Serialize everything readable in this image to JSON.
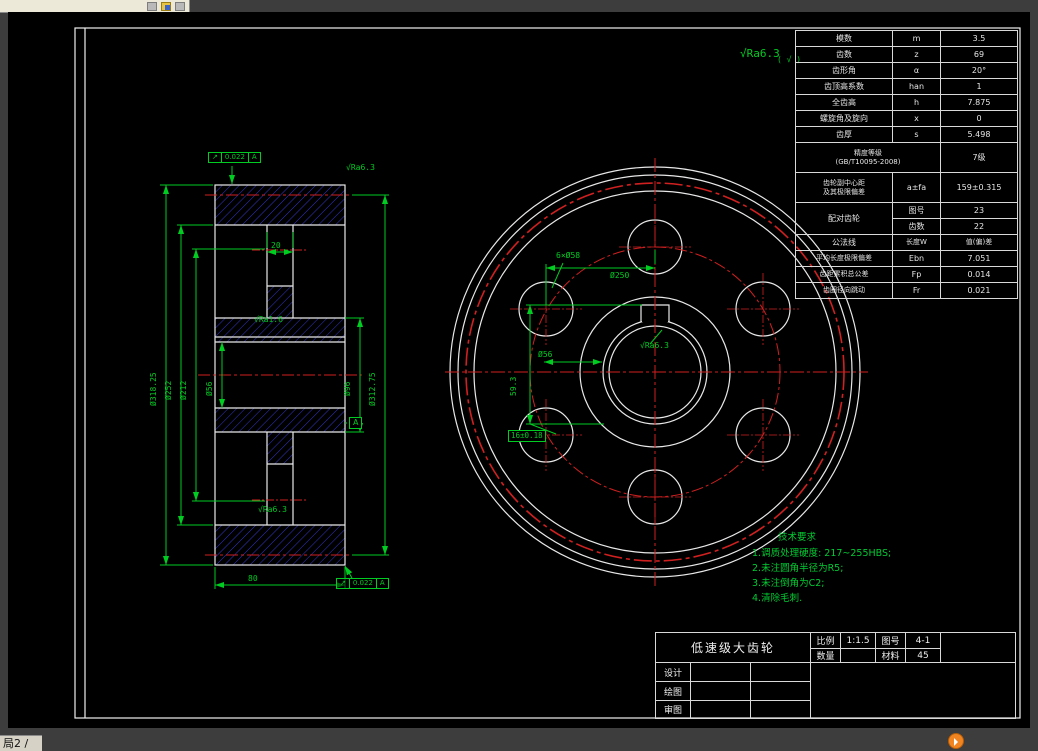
{
  "app": {
    "statusbar_tab": "局2 /"
  },
  "corner_note": {
    "roughness": "√Ra6.3",
    "suffix": "( √ )"
  },
  "param_table": {
    "basic_rows": [
      {
        "label": "模数",
        "sym": "m",
        "val": "3.5"
      },
      {
        "label": "齿数",
        "sym": "z",
        "val": "69"
      },
      {
        "label": "齿形角",
        "sym": "α",
        "val": "20°"
      },
      {
        "label": "齿顶高系数",
        "sym": "han",
        "val": "1"
      },
      {
        "label": "全齿高",
        "sym": "h",
        "val": "7.875"
      },
      {
        "label": "螺旋角及旋向",
        "sym": "x",
        "val": "0"
      },
      {
        "label": "齿厚",
        "sym": "s",
        "val": "5.498"
      }
    ],
    "accuracy": {
      "label": "精度等级",
      "sub": "(GB/T10095-2008)",
      "value": "7级"
    },
    "center_distance": {
      "label1": "齿轮副中心距",
      "label2": "及其极限偏差",
      "sym": "a±fa",
      "value": "159±0.315"
    },
    "mate": {
      "label": "配对齿轮",
      "r1_key": "图号",
      "r1_val": "23",
      "r2_key": "齿数",
      "r2_val": "22"
    },
    "gongfaxian": {
      "label": "公法线",
      "sym": "长度W",
      "value": "值(偏)差"
    },
    "extra_rows": [
      {
        "label": "平均长度极限偏差",
        "sym": "Ebn",
        "val": "7.051"
      },
      {
        "label": "齿距累积总公差",
        "sym": "Fp",
        "val": "0.014"
      },
      {
        "label": "齿圈径向跳动",
        "sym": "Fr",
        "val": "0.021"
      }
    ]
  },
  "left_view": {
    "dim_width_web": "20",
    "dim_width_face": "80",
    "dia_tip": "Ø318.25",
    "dia_rim": "Ø252",
    "dia_holes_span": "Ø212",
    "dia_bore": "Ø56",
    "dia_hub": "Ø96",
    "dia_pitch": "Ø312.75",
    "ra_top": "√Ra6.3",
    "ra_mid": "√Ra1.6",
    "ra_low": "√Ra6.3",
    "tol_top": {
      "sym": "↗",
      "val": "0.022",
      "datum": "A"
    },
    "tol_bottom": {
      "sym": "↗",
      "val": "0.022",
      "datum": "A"
    },
    "datum_flag": "A"
  },
  "right_view": {
    "holes_callout": "6×Ø58",
    "bolt_circle_dia": "Ø250",
    "bore_dia": "Ø56",
    "ra_hub": "√Ra6.3",
    "key_width": "16±0.18",
    "key_depth": "59.3"
  },
  "tech_req": {
    "title": "技术要求",
    "items": [
      "1.调质处理硬度: 217~255HBS;",
      "2.未注圆角半径为R5;",
      "3.未注倒角为C2;",
      "4.清除毛刺."
    ]
  },
  "title_block": {
    "part_name": "低速级大齿轮",
    "scale_label": "比例",
    "scale_value": "1:1.5",
    "sheet_label": "图号",
    "sheet_value": "4-1",
    "qty_label": "数量",
    "qty_value": "",
    "material_label": "材料",
    "material_value": "45",
    "sign_rows": [
      "设计",
      "绘图",
      "审图"
    ]
  }
}
